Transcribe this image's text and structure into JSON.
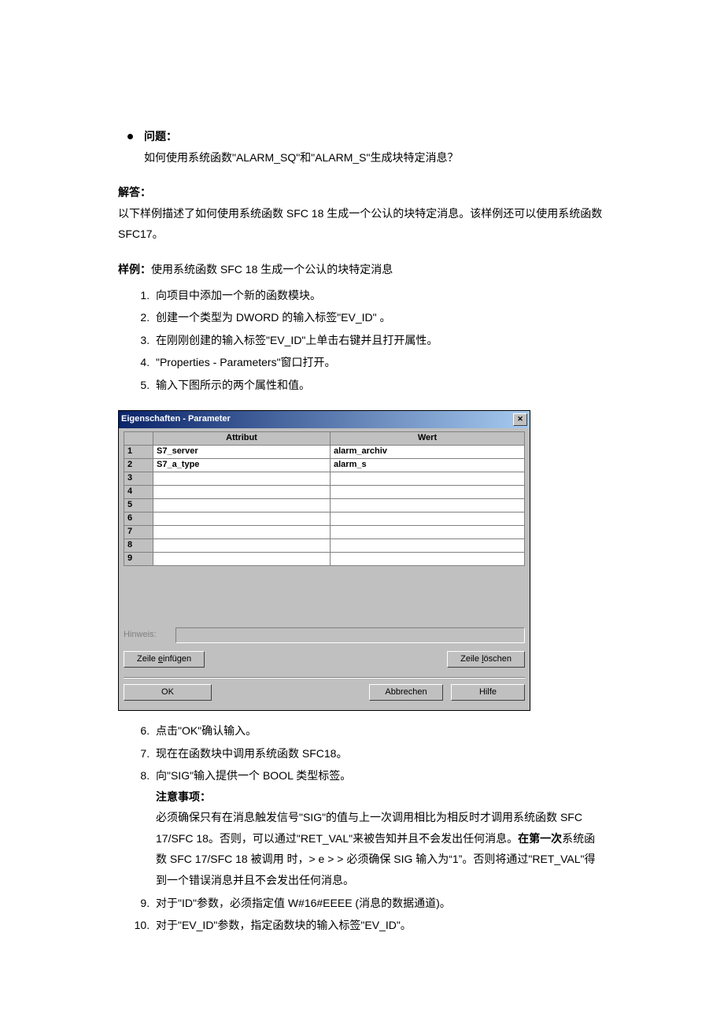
{
  "doc": {
    "question_label": "问题：",
    "question_text": "如何使用系统函数\"ALARM_SQ\"和\"ALARM_S\"生成块特定消息？",
    "answer_label": "解答：",
    "answer_p1": "以下样例描述了如何使用系统函数 SFC 18 生成一个公认的块特定消息。该样例还可以使用系统函数 SFC17。",
    "example_label_bold": "样例：",
    "example_label_rest": "使用系统函数 SFC 18 生成一个公认的块特定消息",
    "steps_a": [
      "向项目中添加一个新的函数模块。",
      "创建一个类型为 DWORD 的输入标签\"EV_ID\" 。",
      "在刚刚创建的输入标签\"EV_ID\"上单击右键并且打开属性。",
      "\"Properties - Parameters\"窗口打开。",
      "输入下图所示的两个属性和值。"
    ],
    "step6": "点击\"OK\"确认输入。",
    "step7": "现在在函数块中调用系统函数 SFC18。",
    "step8": "向\"SIG\"输入提供一个 BOOL 类型标签。",
    "note_label": "注意事项：",
    "note_p_a": "必须确保只有在消息触发信号\"SIG\"的值与上一次调用相比为相反时才调用系统函数 SFC 17/SFC 18。否则，可以通过\"RET_VAL\"来被告知并且不会发出任何消息。",
    "note_bold_b": "在第一次",
    "note_p_b": "系统函数 SFC 17/SFC 18 被调用 时，> e > > 必须确保 SIG 输入为“1”。否则将通过\"RET_VAL\"得到一个错误消息并且不会发出任何消息。",
    "step9": "对于\"ID\"参数，必须指定值 W#16#EEEE (消息的数据通道)。",
    "step10": "对于\"EV_ID\"参数，指定函数块的输入标签\"EV_ID\"。"
  },
  "dialog": {
    "title": "Eigenschaften - Parameter",
    "close": "✕",
    "col_attr": "Attribut",
    "col_wert": "Wert",
    "rows": [
      {
        "n": "1",
        "attr": "S7_server",
        "wert": "alarm_archiv"
      },
      {
        "n": "2",
        "attr": "S7_a_type",
        "wert": "alarm_s"
      },
      {
        "n": "3",
        "attr": "",
        "wert": ""
      },
      {
        "n": "4",
        "attr": "",
        "wert": ""
      },
      {
        "n": "5",
        "attr": "",
        "wert": ""
      },
      {
        "n": "6",
        "attr": "",
        "wert": ""
      },
      {
        "n": "7",
        "attr": "",
        "wert": ""
      },
      {
        "n": "8",
        "attr": "",
        "wert": ""
      },
      {
        "n": "9",
        "attr": "",
        "wert": ""
      }
    ],
    "hinweis_label": "Hinweis:",
    "btn_insert_pre": "Zeile ",
    "btn_insert_u": "e",
    "btn_insert_post": "infügen",
    "btn_delete_pre": "Zeile ",
    "btn_delete_u": "l",
    "btn_delete_post": "öschen",
    "btn_ok": "OK",
    "btn_cancel": "Abbrechen",
    "btn_help": "Hilfe"
  }
}
